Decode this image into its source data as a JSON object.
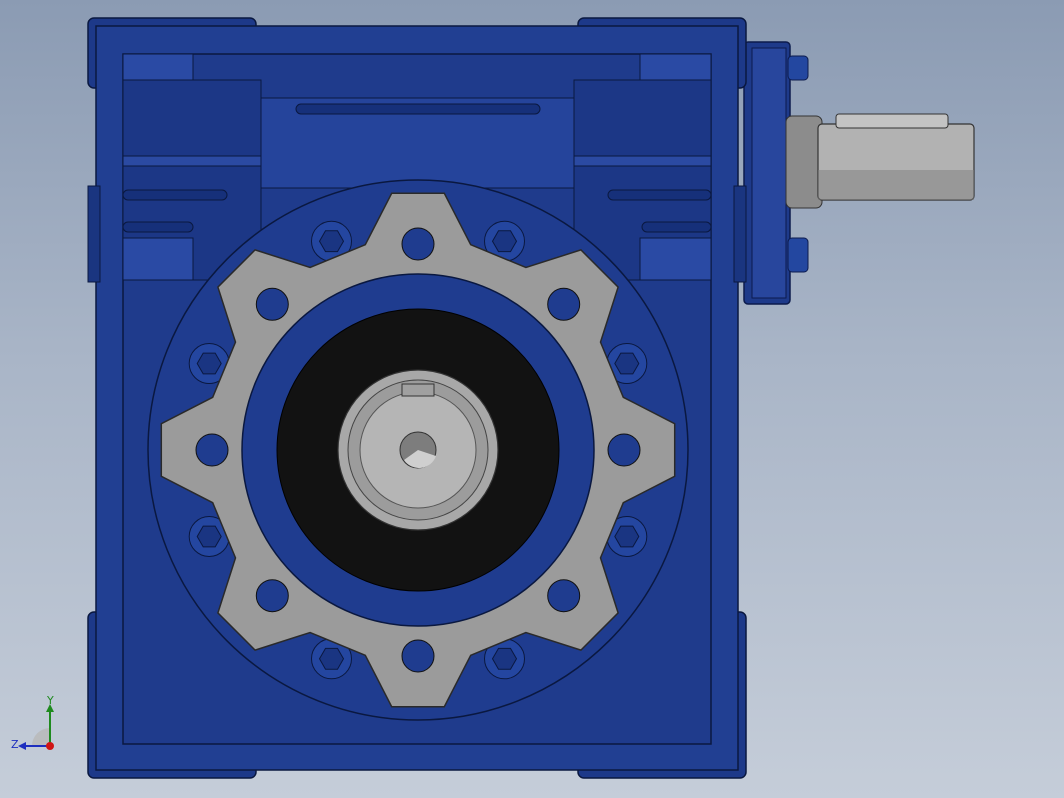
{
  "viewport": {
    "colors": {
      "background_top": "#8b9bb3",
      "background_bottom": "#c5cdd9",
      "housing": "#1f3b8c",
      "housing_dark": "#13266a",
      "housing_light": "#2c4aa3",
      "flange": "#9a9a9a",
      "shaft": "#b4b4b4",
      "bore": "#111111"
    }
  },
  "model": {
    "housing_icon": "worm-gearbox-housing",
    "flange_icon": "output-flange",
    "input_shaft_icon": "input-shaft",
    "output_shaft_icon": "output-shaft"
  },
  "triad": {
    "x_label": "",
    "y_label": "Y",
    "z_label": "Z",
    "colors": {
      "y": "#1e8a1e",
      "z": "#1e2fbf",
      "x": "#d01515"
    }
  }
}
